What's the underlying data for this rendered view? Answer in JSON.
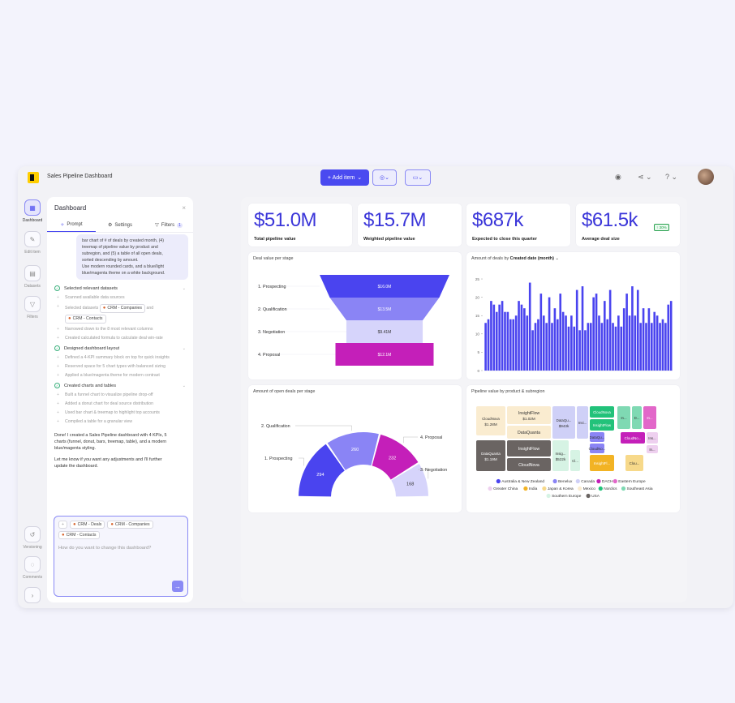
{
  "app": {
    "title": "Sales Pipeline Dashboard",
    "add_item_label": "+ Add item",
    "colors": {
      "accent": "#4a4af0",
      "brand": "#ffce00"
    }
  },
  "rail": {
    "items": [
      {
        "label": "Dashboard",
        "icon": "grid-icon"
      },
      {
        "label": "Edit item",
        "icon": "edit-icon"
      },
      {
        "label": "Datasets",
        "icon": "table-icon"
      },
      {
        "label": "Filters",
        "icon": "filter-icon"
      }
    ],
    "bottom": [
      {
        "label": "Versioning",
        "icon": "history-icon"
      },
      {
        "label": "Comments",
        "icon": "comment-icon"
      }
    ]
  },
  "panel": {
    "title": "Dashboard",
    "tabs": {
      "prompt": "Prompt",
      "settings": "Settings",
      "filters": "Filters",
      "filters_count": "1"
    },
    "prompt_text": [
      "bar chart of # of deals by created month, (4)",
      "treemap of pipeline value by product and",
      "subregion, and (5) a table of all open deals,",
      "sorted descending by amount.",
      "Use modern rounded cards, and a blue/light",
      "blue/magenta theme on a white background."
    ],
    "steps": [
      {
        "title": "Selected relevant datasets",
        "subs": [
          "Scanned available data sources",
          "Narrowed down to the 8 most relevant columns",
          "Created calculated formula to calculate deal win-rate"
        ],
        "selected_prefix": "Selected datasets",
        "chip_companies": "CRM - Companies",
        "and_word": "and",
        "chip_contacts": "CRM - Contacts"
      },
      {
        "title": "Designed dashboard layout",
        "subs": [
          "Defined a 4-KPI summary block on top for quick insights",
          "Reserved space for 5 chart types with balanced sizing",
          "Applied a blue/magenta theme for modern contrast"
        ]
      },
      {
        "title": "Created charts and tables",
        "subs": [
          "Built a funnel chart to visualize pipeline drop-off",
          "Added a donut chart for deal source distribution",
          "Used bar chart & treemap to highlight top accounts",
          "Compiled a table for a granular view"
        ]
      }
    ],
    "done_message": [
      "Done! I created a Sales Pipeline dashboard with 4 KPIs, 5",
      "charts (funnel, donut, bars, treemap, table), and a modern",
      "blue/magenta styling."
    ],
    "followup_message": [
      "Let me know if you want any adjustments and I'll further",
      "update the dashboard."
    ],
    "composer": {
      "chips": [
        "CRM - Deals",
        "CRM - Companies",
        "CRM - Contacts"
      ],
      "placeholder": "How do you want to change this dashboard?"
    }
  },
  "kpis": [
    {
      "value": "$51.0M",
      "label": "Total pipeline value"
    },
    {
      "value": "$15.7M",
      "label": "Weighted pipeline value"
    },
    {
      "value": "$687k",
      "label": "Expected to close this quarter"
    },
    {
      "value": "$61.5k",
      "label": "Average deal size",
      "badge": "↑ 30%"
    }
  ],
  "chart_data": [
    {
      "type": "bar",
      "title": "Deal value per stage",
      "categories": [
        "1. Prospecting",
        "2. Qualification",
        "3. Negotiation",
        "4. Proposal"
      ],
      "values": [
        16.0,
        13.5,
        9.41,
        12.1
      ],
      "labels": [
        "$16.0M",
        "$13.5M",
        "$9.41M",
        "$12.1M"
      ],
      "colors": [
        "#4a44ef",
        "#8a84f5",
        "#d6d4fb",
        "#c41fb9"
      ]
    },
    {
      "type": "bar",
      "title_prefix": "Amount of deals",
      "title_by": "by",
      "title_dim": "Created date (month)",
      "yticks": [
        0,
        5,
        10,
        15,
        20,
        25
      ],
      "ylim": [
        0,
        27
      ],
      "values": [
        13,
        14,
        19,
        18,
        16,
        18,
        19,
        16,
        16,
        14,
        14,
        15,
        19,
        18,
        17,
        15,
        24,
        11,
        13,
        14,
        21,
        15,
        13,
        20,
        13,
        17,
        14,
        21,
        16,
        15,
        12,
        15,
        12,
        22,
        11,
        23,
        11,
        13,
        13,
        20,
        21,
        15,
        13,
        19,
        14,
        22,
        13,
        12,
        15,
        12,
        17,
        21,
        15,
        23,
        15,
        22,
        13,
        17,
        13,
        17,
        13,
        16,
        15,
        13,
        14,
        13,
        18,
        19
      ],
      "color": "#4a44ef"
    },
    {
      "type": "pie",
      "title": "Amount of open deals per stage",
      "categories": [
        "1. Prospecting",
        "2. Qualification",
        "4. Proposal",
        "3. Negotiation"
      ],
      "values": [
        294,
        260,
        232,
        168
      ],
      "colors": [
        "#4a44ef",
        "#8a84f5",
        "#c41fb9",
        "#d6d4fb"
      ]
    },
    {
      "type": "heatmap",
      "title": "Pipeline value by product & subregion",
      "tiles": [
        {
          "name": "CloudNova",
          "value": "$1.28M"
        },
        {
          "name": "InsightFlow",
          "value": "$1.02M"
        },
        {
          "name": "DataQuanta",
          "value": ""
        },
        {
          "name": "DataQu...",
          "value": "$943k"
        },
        {
          "name": "Insi...",
          "value": ""
        },
        {
          "name": "CloudNova",
          "value": ""
        },
        {
          "name": "InsightFlow",
          "value": ""
        },
        {
          "name": "DataQu...",
          "value": ""
        },
        {
          "name": "CloudNo...",
          "value": ""
        },
        {
          "name": "In...",
          "value": ""
        },
        {
          "name": "D...",
          "value": ""
        },
        {
          "name": "In...",
          "value": ""
        },
        {
          "name": "DataQuanta",
          "value": "$1.19M"
        },
        {
          "name": "InsightFlow",
          "value": ""
        },
        {
          "name": "CloudNova",
          "value": ""
        },
        {
          "name": "Insig...",
          "value": "$522k"
        },
        {
          "name": "Cl...",
          "value": ""
        },
        {
          "name": "InsightFl...",
          "value": ""
        },
        {
          "name": "Clou...",
          "value": ""
        },
        {
          "name": "CloudNo...",
          "value": ""
        },
        {
          "name": "Ins...",
          "value": ""
        },
        {
          "name": "In...",
          "value": ""
        }
      ],
      "legend": [
        {
          "name": "Australia & New Zealand",
          "color": "#4a44ef"
        },
        {
          "name": "Benelux",
          "color": "#8a84f5"
        },
        {
          "name": "Canada",
          "color": "#cfd0f7"
        },
        {
          "name": "DACH",
          "color": "#c41fb9"
        },
        {
          "name": "Eastern Europe",
          "color": "#e267c9"
        },
        {
          "name": "Greater China",
          "color": "#eed0ef"
        },
        {
          "name": "India",
          "color": "#f2b324"
        },
        {
          "name": "Japan & Korea",
          "color": "#f7d98a"
        },
        {
          "name": "Mexico",
          "color": "#faecd0"
        },
        {
          "name": "Nordics",
          "color": "#22c27a"
        },
        {
          "name": "Southeast Asia",
          "color": "#7fd9b3"
        },
        {
          "name": "Southern Europe",
          "color": "#d6f3e4"
        },
        {
          "name": "USA",
          "color": "#6a6462"
        }
      ]
    }
  ]
}
